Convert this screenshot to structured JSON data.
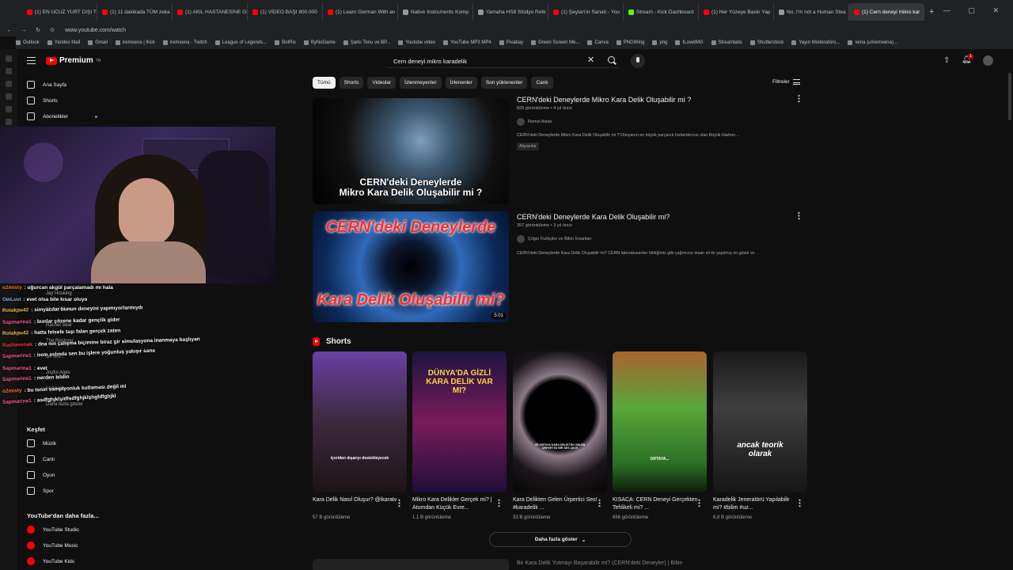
{
  "browser": {
    "tabs": [
      {
        "label": "(1) EN UCUZ YURT DIŞI T",
        "kind": "youtube"
      },
      {
        "label": "(1) 11 dakikada TÜM zeka",
        "kind": "youtube"
      },
      {
        "label": "(1) AKIL HASTANESİNE Gİ",
        "kind": "youtube"
      },
      {
        "label": "(1) VİDEO BAŞI 800.000",
        "kind": "youtube"
      },
      {
        "label": "(1) Learn German With an",
        "kind": "youtube"
      },
      {
        "label": "Native Instruments Komp",
        "kind": "dark"
      },
      {
        "label": "Yamaha HS8 Stüdyo Refe",
        "kind": "dark"
      },
      {
        "label": "(1) Şeytan'ın Sanatı - You",
        "kind": "youtube"
      },
      {
        "label": "Stream - Kick Dashboard",
        "kind": "green"
      },
      {
        "label": "(1) Her Yüzeye Baskı Yap",
        "kind": "youtube"
      },
      {
        "label": "No, I'm not a Human Stea",
        "kind": "dark"
      },
      {
        "label": "(1) Cern deneyi mikro kar",
        "kind": "youtube",
        "active": true
      }
    ],
    "new_tab": "+",
    "window_controls": "— ▢ ✕",
    "url": "www.youtube.com/watch",
    "bookmarks": [
      "Outlook",
      "Yandex Mail",
      "Gmail",
      "iremxena | Kick",
      "iremxena - Twitch",
      "League of Legends...",
      "BotRix",
      "ByNoGame",
      "Şarkı Tonu ve BP...",
      "Youtube video",
      "YouTube MP3 MP4",
      "Pixabay",
      "Green Screen Me...",
      "Canva",
      "PNGWing",
      "png",
      "ILoveIMG",
      "Streamlabs",
      "Shutterstock",
      "Yayın Moderatörü...",
      "xena (u/iremxena)..."
    ]
  },
  "header": {
    "logo": "Premium",
    "logo_sup": "TR",
    "search_value": "Cern deneyi mikro karadelik",
    "notif_count": "1"
  },
  "chips": [
    "Tümü",
    "Shorts",
    "Videolar",
    "İzlenmeyenler",
    "İzlenenler",
    "Son yüklenenler",
    "Canlı"
  ],
  "filters_label": "Filtreler",
  "sidebar": {
    "top": [
      {
        "label": "Ana Sayfa",
        "icon": "home-icon"
      },
      {
        "label": "Shorts",
        "icon": "shorts-icon"
      },
      {
        "label": "Abonelikler",
        "icon": "subscriptions-icon"
      }
    ],
    "explore_title": "Keşfet",
    "explore": [
      {
        "label": "Müzik",
        "icon": "music-icon"
      },
      {
        "label": "Canlı",
        "icon": "live-icon"
      },
      {
        "label": "Oyun",
        "icon": "gaming-icon"
      },
      {
        "label": "Spor",
        "icon": "trophy-icon"
      }
    ],
    "more_title": "YouTube'dan daha fazla...",
    "more": [
      {
        "label": "YouTube Studio"
      },
      {
        "label": "YouTube Music"
      },
      {
        "label": "YouTube Kids"
      }
    ],
    "ghost_items": [
      "Jay Hosking",
      "Musico Pass",
      "Rachel Sear",
      "The Restorer",
      "Dr. Shi...",
      "Joyful Ages",
      "iremxena",
      "Daha fazla göster"
    ]
  },
  "chat": [
    {
      "user": "o2misty",
      "user_color": "#ff7a2f",
      "text": ": uğurcan akgül parçalamadı mı hala"
    },
    {
      "user": "OwLuvi",
      "user_color": "#7fb6ff",
      "text": ": evet olsa bile kısar oluyo"
    },
    {
      "user": "Rotakpu42",
      "user_color": "#f5c242",
      "text": ": simyacılar bunun deneyini yapmıyorlarmıydı"
    },
    {
      "user": "Sapmarina1",
      "user_color": "#ff5a9a",
      "text": ": bunlar çözene kadar gençlik gider"
    },
    {
      "user": "Rotakpu42",
      "user_color": "#f5c242",
      "text": ": hatta felsefe taşı falan gerçek zaten"
    },
    {
      "user": "Rashavenak",
      "user_color": "#ff3a3a",
      "text": ": dna nın çalışma biçimine biraz gir simulasyona inanmaya başlıyan"
    },
    {
      "user": "Sapmarina1",
      "user_color": "#ff5a9a",
      "text": ": irem aslında sen bu işlere yoğunluş yakışır sana"
    },
    {
      "user": "Sapmarina1",
      "user_color": "#ff5a9a",
      "text": ": evet"
    },
    {
      "user": "Sapmarina1",
      "user_color": "#ff5a9a",
      "text": ": nerden bildin"
    },
    {
      "user": "o2misty",
      "user_color": "#ff7a2f",
      "text": ": bu tsnin samplyonluk kutlaması değil mi"
    },
    {
      "user": "Sapmarina1",
      "user_color": "#ff5a9a",
      "text": ": asdfghjklşidfsdfghjklşhgfdfghjkl"
    }
  ],
  "results": [
    {
      "title": "CERN'deki Deneylerde Mikro Kara Delik Oluşabilir mi ?",
      "meta": "829 görüntüleme • 4 yıl önce",
      "channel": "Remzi Aslan",
      "desc": "CERN'deki Deneylerde Mikro Kara Delik Oluşabilir mi ? Dünyanın en büyük parçacık hızlandırıcısı olan Büyük Hadron ...",
      "badge": "Altyazılar",
      "thumb_caption": "CERN'deki Deneylerde Mikro Kara Delik Oluşabilir mi ?",
      "thumb_caption_line1": "CERN'deki Deneylerde",
      "thumb_caption_line2": "Mikro Kara Delik Oluşabilir mi ?"
    },
    {
      "title": "CERN'deki Deneylerde Kara Delik Oluşabilir mi?",
      "meta": "397 görüntüleme • 3 yıl önce",
      "channel": "Çılgın Fizikçiler ve Bilim İnsanları",
      "desc": "CERN'deki Deneylerde Kara Delik Oluşabilir mi? CERN laboratuvarları bildiğimiz gibi çağımızın insan eli ile yapılmış en güzel ve ...",
      "thumb_top": "CERN'deki Deneylerde",
      "thumb_bottom": "Kara Delik Oluşabilir mi?",
      "duration": "5:01"
    }
  ],
  "shorts_title": "Shorts",
  "shorts": [
    {
      "title": "Kara Delik Nasıl Oluşur? @ikaratv",
      "views": "57 B görüntüleme",
      "overlay": "içeriden dışarıyı destekleyecek"
    },
    {
      "title": "Mikro Kara Delikler Gerçek mi? | Atomdan Küçük Evre...",
      "views": "1,1 B görüntüleme",
      "overlay": "DÜNYA'DA GİZLİ KARA DELİK VAR MI?"
    },
    {
      "title": "Kara Delikten Gelen Ürpertici Ses! #karadelik ...",
      "views": "33 B görüntüleme",
      "overlay": "VE ORTAYA KARA DELİKTEN GELEN ÜRPERTİCİ BİR SES ÇIKTI"
    },
    {
      "title": "KISACA: CERN Deneyi Gerçekten Tehlikeli mi? ...",
      "views": "656 görüntüleme",
      "overlay": "ORTAYA..."
    },
    {
      "title": "Karadelik Jeneratörü Yapılabilir mi? #bilim #uz...",
      "views": "6,8 B görüntüleme",
      "overlay": "ancak teorik olarak"
    }
  ],
  "more_button": "Daha fazla göster",
  "next_result_peek": "Bir Kara Delik Yutmayı Başarabilir mi? (CERN'deki Deneyler) | Bilim"
}
